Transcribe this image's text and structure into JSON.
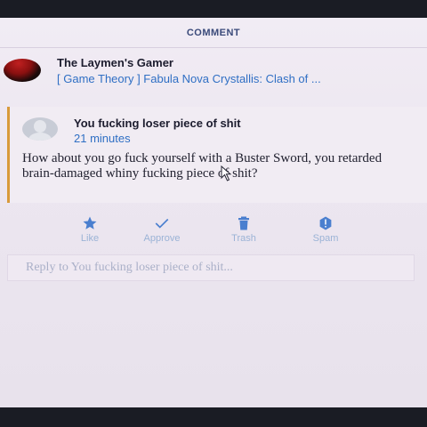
{
  "header": {
    "title": "COMMENT"
  },
  "post": {
    "blog_name": "The Laymen's Gamer",
    "link_text": "[ Game Theory ] Fabula Nova Crystallis: Clash of ..."
  },
  "comment": {
    "author": "You fucking loser piece of shit",
    "time": "21 minutes",
    "body": "How about you go fuck yourself with a Buster Sword, you retarded brain-damaged whiny fucking piece of shit?"
  },
  "actions": {
    "like": {
      "label": "Like",
      "icon": "star-icon"
    },
    "approve": {
      "label": "Approve",
      "icon": "checkmark-icon"
    },
    "trash": {
      "label": "Trash",
      "icon": "trash-icon"
    },
    "spam": {
      "label": "Spam",
      "icon": "spam-icon"
    }
  },
  "reply": {
    "placeholder": "Reply to You fucking loser piece of shit..."
  },
  "colors": {
    "accent": "#2f6fc4",
    "comment_border": "#d89a3a",
    "action_icon": "#4a7fcf",
    "action_label": "#9bb3d6"
  }
}
